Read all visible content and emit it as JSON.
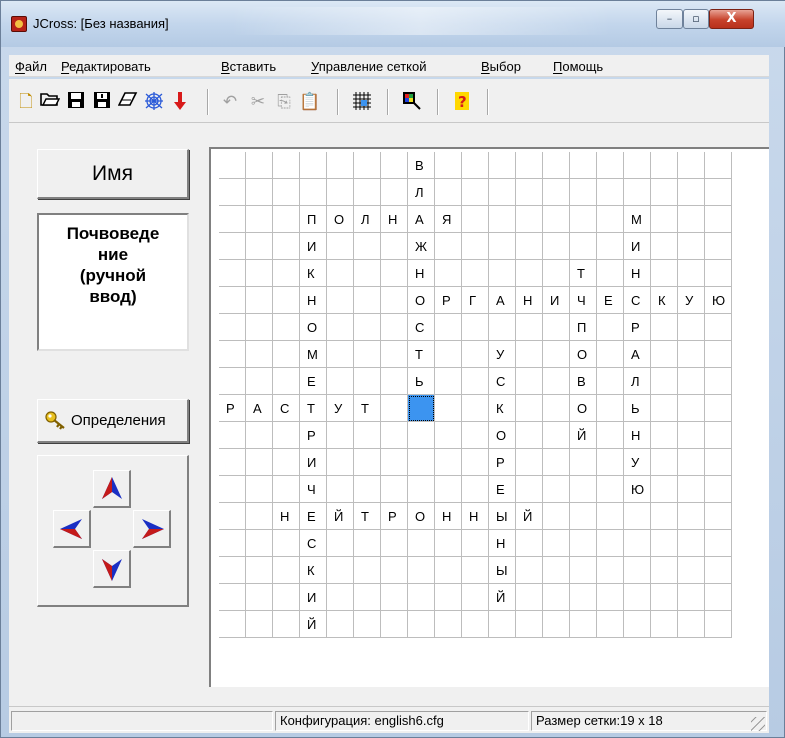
{
  "window": {
    "title": "JCross: [Без названия]",
    "minimize": "–",
    "maximize": "▫",
    "close": "X"
  },
  "menu": [
    {
      "first": "Ф",
      "rest": "айл"
    },
    {
      "first": "Р",
      "rest": "едактировать"
    },
    {
      "first": "В",
      "rest": "ставить"
    },
    {
      "first": "У",
      "rest": "правление сеткой"
    },
    {
      "first": "В",
      "rest": "ыбор"
    },
    {
      "first": "П",
      "rest": "омощь"
    }
  ],
  "toolbar": {
    "icons": [
      "new-file-icon",
      "open-folder-icon",
      "save-icon",
      "save-as-icon",
      "eraser-icon",
      "web-icon",
      "red-arrow-down-icon",
      "undo-icon",
      "cut-icon",
      "copy-icon",
      "paste-icon",
      "grid-icon",
      "colors-icon",
      "help-icon"
    ]
  },
  "left_panel": {
    "name_label": "Имя",
    "topic_lines": [
      "Почвоведе",
      "ние",
      "(ручной",
      "ввод)"
    ],
    "definitions_label": "Определения"
  },
  "grid": {
    "cols": 19,
    "rows": 18,
    "selected_cell": [
      7,
      9
    ],
    "rows_text": [
      "       В           ",
      "       Л           ",
      "   ПОЛНАЯ      М   ",
      "   И   Ж       И   ",
      "   К   Н     Т Н   ",
      "   Н   ОРГАНИЧЕСКУЮ",
      "   О   С     П Р   ",
      "   М   Т  У  О А   ",
      "   Е   Ь  С  В Л   ",
      "РАСТУТ    К  О Ь   ",
      "   Р      О  Й Н   ",
      "   И      Р    У   ",
      "   Ч      Е    Ю   ",
      "  НЕЙТРОННЫЙ       ",
      "   С      Н        ",
      "   К      Ы        ",
      "   И      Й        ",
      "   Й               "
    ]
  },
  "status": {
    "config": "Конфигурация: english6.cfg",
    "size": "Размер сетки:19 x 18"
  },
  "colors": {
    "selected_cell": "#3c94f0",
    "arrow_blue": "#1a2fc4",
    "arrow_red": "#c41a1a"
  }
}
